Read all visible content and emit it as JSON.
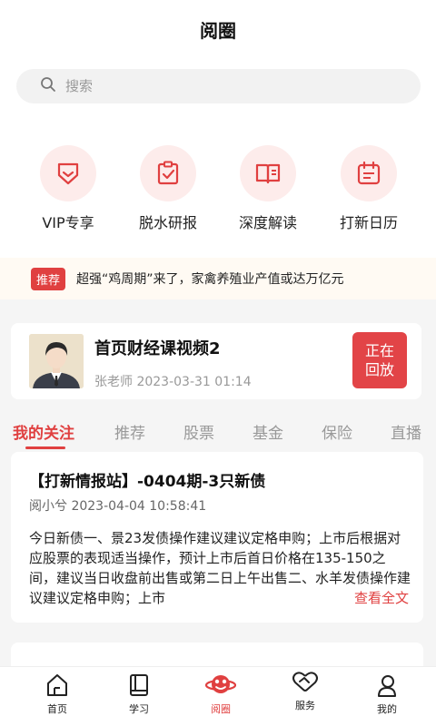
{
  "header": {
    "title": "阅圈"
  },
  "search": {
    "placeholder": "搜索"
  },
  "quick_links": [
    {
      "label": "VIP专享",
      "icon": "vip-icon"
    },
    {
      "label": "脱水研报",
      "icon": "report-icon"
    },
    {
      "label": "深度解读",
      "icon": "book-icon"
    },
    {
      "label": "打新日历",
      "icon": "calendar-icon"
    }
  ],
  "notice": {
    "badge": "推荐",
    "text": "超强“鸡周期”来了，家禽养殖业产值或达万亿元"
  },
  "live": {
    "title": "首页财经课视频2",
    "meta": "张老师 2023-03-31 01:14",
    "button": "正在\n回放"
  },
  "tabs": [
    "我的关注",
    "推荐",
    "股票",
    "基金",
    "保险",
    "直播"
  ],
  "article": {
    "title": "【打新情报站】-0404期-3只新债",
    "meta": "阅小兮 2023-04-04 10:58:41",
    "body": "今日新债一、景23发债操作建议建议定格申购；上市后根据对应股票的表现适当操作，预计上市后首日价格在135-150之间，建议当日收盘前出售或第二日上午出售二、水羊发债操作建议建议定格申购；上市",
    "readmore": "查看全文"
  },
  "bottom_nav": [
    {
      "label": "首页",
      "icon": "home-icon"
    },
    {
      "label": "学习",
      "icon": "study-book-icon"
    },
    {
      "label": "阅圈",
      "icon": "planet-icon"
    },
    {
      "label": "服务",
      "icon": "handshake-icon"
    },
    {
      "label": "我的",
      "icon": "profile-icon"
    }
  ],
  "colors": {
    "accent": "#e04040",
    "icon_bg": "#fdeceb"
  }
}
